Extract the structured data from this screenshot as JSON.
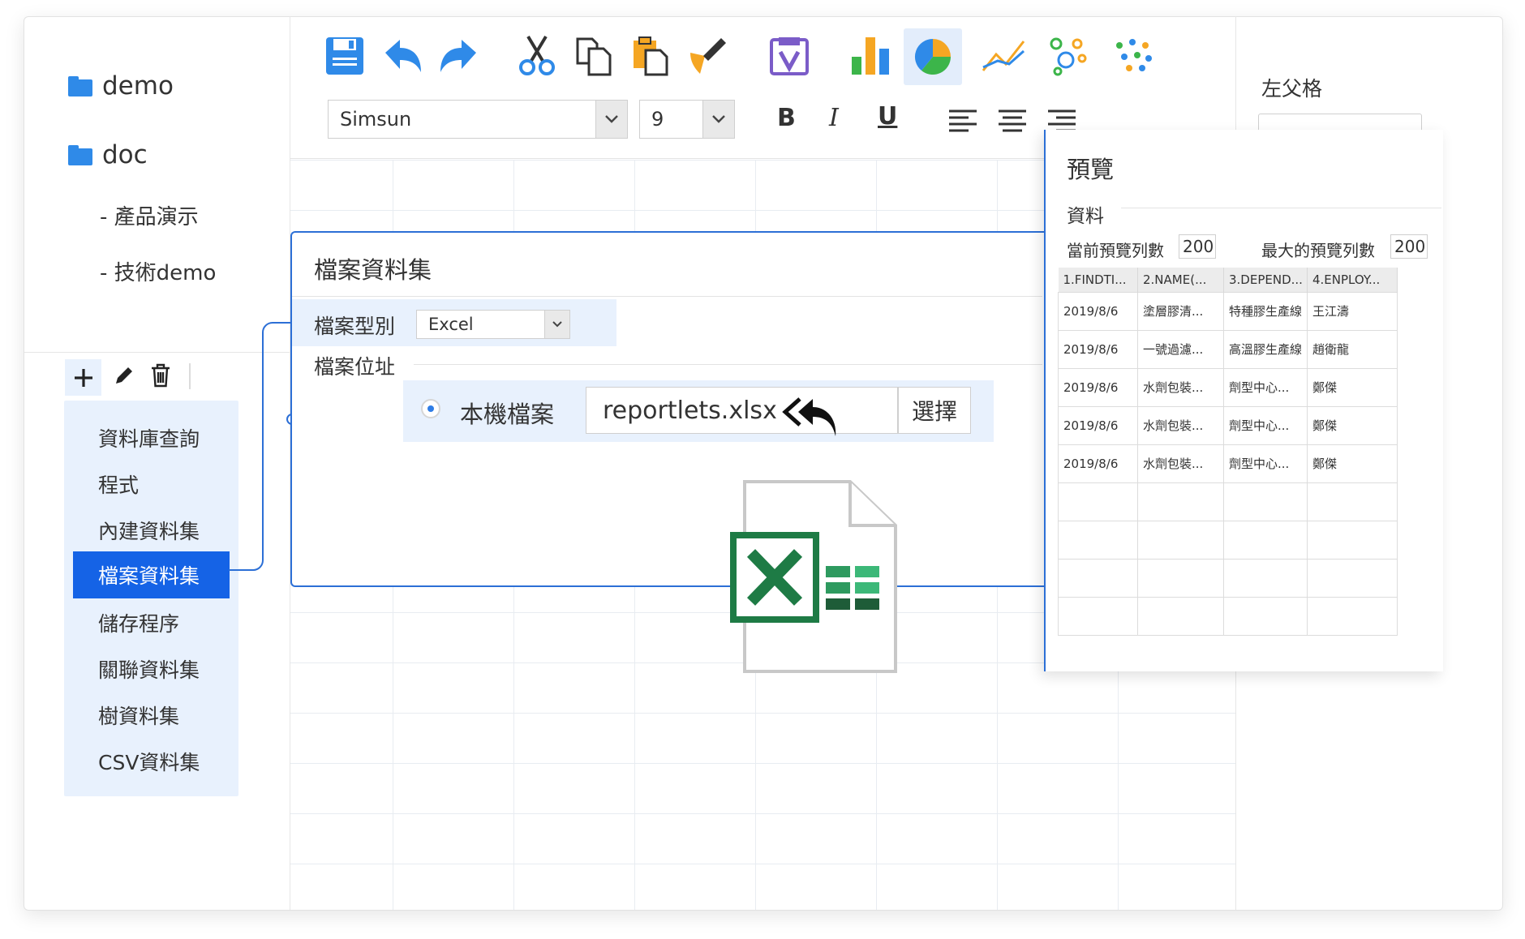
{
  "folder_tree": {
    "folders": [
      "demo",
      "doc"
    ],
    "sub_items": [
      "- 產品演示",
      "- 技術demo"
    ]
  },
  "left_toolbar": {
    "icons": [
      "add-icon",
      "edit-icon",
      "delete-icon"
    ]
  },
  "dataset_types": [
    "資料庫查詢",
    "程式",
    "內建資料集",
    "檔案資料集",
    "儲存程序",
    "關聯資料集",
    "樹資料集",
    "CSV資料集"
  ],
  "active_dataset_type": "檔案資料集",
  "toolbar": {
    "icons": [
      "save-icon",
      "undo-icon",
      "redo-icon",
      "cut-icon",
      "copy-icon",
      "paste-icon",
      "format-painter-icon",
      "validate-icon",
      "bar-chart-icon",
      "pie-chart-icon",
      "line-chart-icon",
      "bubble-chart-icon",
      "scatter-chart-icon"
    ],
    "font_family": "Simsun",
    "font_size": "9",
    "bold": "B",
    "italic": "I",
    "underline": "U"
  },
  "dialog": {
    "title": "檔案資料集",
    "file_type_label": "檔案型別",
    "file_type_value": "Excel",
    "file_path_label": "檔案位址",
    "local_file_label": "本機檔案",
    "file_name": "reportlets.xlsx",
    "choose_button": "選擇"
  },
  "preview": {
    "title": "預覽",
    "section": "資料",
    "current_rows_label": "當前預覽列數",
    "current_rows_value": "200",
    "max_rows_label": "最大的預覽列數",
    "max_rows_value": "200",
    "columns": [
      "1.FINDTI...",
      "2.NAME(...",
      "3.DEPEND...",
      "4.ENPLOY..."
    ],
    "rows": [
      [
        "2019/8/6",
        "塗層膠清...",
        "特種膠生產線",
        "王江濤"
      ],
      [
        "2019/8/6",
        "一號過濾...",
        "高溫膠生產線",
        "趙衛龍"
      ],
      [
        "2019/8/6",
        "水劑包裝...",
        "劑型中心...",
        "鄭傑"
      ],
      [
        "2019/8/6",
        "水劑包裝...",
        "劑型中心...",
        "鄭傑"
      ],
      [
        "2019/8/6",
        "水劑包裝...",
        "劑型中心...",
        "鄭傑"
      ]
    ],
    "empty_rows": 4
  },
  "right_panel": {
    "label": "左父格"
  },
  "colors": {
    "accent": "#1563e6",
    "panel_blue": "#e8f1fd",
    "border_blue": "#2c6fd6",
    "excel_green": "#1e7b45"
  }
}
